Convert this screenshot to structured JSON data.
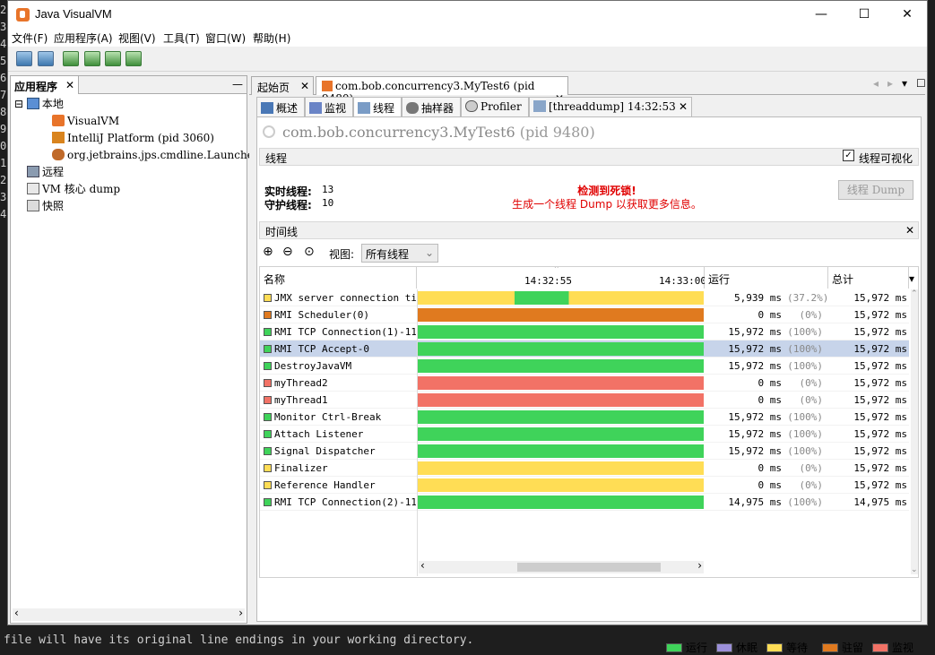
{
  "background": {
    "line_numbers": [
      "2",
      "3",
      "4",
      "5",
      "6",
      "7",
      "8",
      "9",
      "0",
      "1",
      "2",
      "3",
      "4"
    ],
    "bottom_line": "file will have its original line endings in your working directory."
  },
  "window": {
    "title": "Java VisualVM",
    "minimize": "—",
    "maximize": "☐",
    "close": "✕"
  },
  "menu": [
    "文件(F)",
    "应用程序(A)",
    "视图(V)",
    "工具(T)",
    "窗口(W)",
    "帮助(H)"
  ],
  "left": {
    "tab": "应用程序",
    "tree": [
      "本地",
      "VisualVM",
      "IntelliJ Platform (pid 3060)",
      "org.jetbrains.jps.cmdline.Launcher",
      "远程",
      "VM 核心 dump",
      "快照"
    ]
  },
  "doc_tabs": [
    "起始页",
    "com.bob.concurrency3.MyTest6 (pid 9480)"
  ],
  "sub_tabs": [
    "概述",
    "监视",
    "线程",
    "抽样器",
    "Profiler",
    "[threaddump] 14:32:53"
  ],
  "app_title": "com.bob.concurrency3.MyTest6",
  "app_pid": "(pid 9480)",
  "threads": {
    "section": "线程",
    "visualize_label": "线程可视化",
    "visualize_checked": true,
    "live_label": "实时线程:",
    "live_value": "13",
    "daemon_label": "守护线程:",
    "daemon_value": "10",
    "deadlock_title": "检测到死锁!",
    "deadlock_msg": "生成一个线程 Dump 以获取更多信息。",
    "dump_button": "线程 Dump"
  },
  "timeline": {
    "section": "时间线",
    "view_label": "视图:",
    "view_value": "所有线程",
    "col_name": "名称",
    "col_run": "运行",
    "col_total": "总计",
    "time1": "14:32:55",
    "time2": "14:33:00",
    "rows": [
      {
        "name": "JMX server connection timeout",
        "state": "wait",
        "run": "5,939 ms",
        "pct": "(37.2%)",
        "total": "15,972 ms"
      },
      {
        "name": "RMI Scheduler(0)",
        "state": "park",
        "run": "0 ms",
        "pct": "(0%)",
        "total": "15,972 ms"
      },
      {
        "name": "RMI TCP Connection(1)-11.24",
        "state": "run",
        "run": "15,972 ms",
        "pct": "(100%)",
        "total": "15,972 ms"
      },
      {
        "name": "RMI TCP Accept-0",
        "state": "run",
        "run": "15,972 ms",
        "pct": "(100%)",
        "total": "15,972 ms",
        "selected": true
      },
      {
        "name": "DestroyJavaVM",
        "state": "run",
        "run": "15,972 ms",
        "pct": "(100%)",
        "total": "15,972 ms"
      },
      {
        "name": "myThread2",
        "state": "monitor",
        "run": "0 ms",
        "pct": "(0%)",
        "total": "15,972 ms"
      },
      {
        "name": "myThread1",
        "state": "monitor",
        "run": "0 ms",
        "pct": "(0%)",
        "total": "15,972 ms"
      },
      {
        "name": "Monitor Ctrl-Break",
        "state": "run",
        "run": "15,972 ms",
        "pct": "(100%)",
        "total": "15,972 ms"
      },
      {
        "name": "Attach Listener",
        "state": "run",
        "run": "15,972 ms",
        "pct": "(100%)",
        "total": "15,972 ms"
      },
      {
        "name": "Signal Dispatcher",
        "state": "run",
        "run": "15,972 ms",
        "pct": "(100%)",
        "total": "15,972 ms"
      },
      {
        "name": "Finalizer",
        "state": "wait",
        "run": "0 ms",
        "pct": "(0%)",
        "total": "15,972 ms"
      },
      {
        "name": "Reference Handler",
        "state": "wait",
        "run": "0 ms",
        "pct": "(0%)",
        "total": "15,972 ms"
      },
      {
        "name": "RMI TCP Connection(2)-11.24",
        "state": "run",
        "run": "14,975 ms",
        "pct": "(100%)",
        "total": "14,975 ms"
      }
    ]
  },
  "legend": [
    {
      "label": "运行",
      "color": "#3fd35a"
    },
    {
      "label": "休眠",
      "color": "#9b8fd9"
    },
    {
      "label": "等待",
      "color": "#ffdd55"
    },
    {
      "label": "驻留",
      "color": "#e07a1f"
    },
    {
      "label": "监视",
      "color": "#f27266"
    }
  ],
  "colors": {
    "run": "#3fd35a",
    "wait": "#ffdd55",
    "park": "#e07a1f",
    "monitor": "#f27266",
    "sleep": "#9b8fd9"
  }
}
